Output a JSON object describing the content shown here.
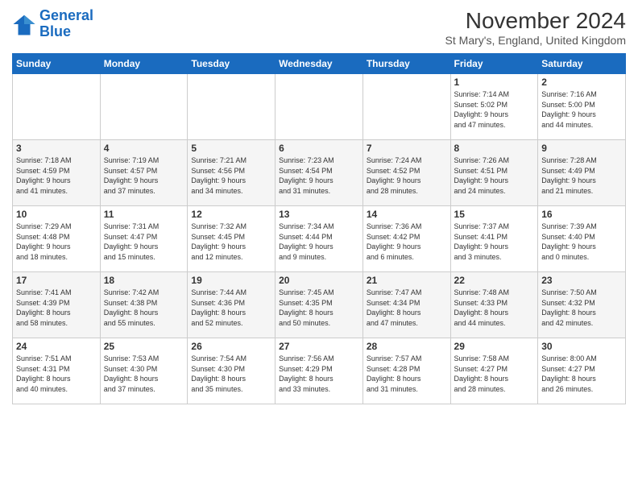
{
  "logo": {
    "line1": "General",
    "line2": "Blue"
  },
  "title": "November 2024",
  "subtitle": "St Mary's, England, United Kingdom",
  "weekdays": [
    "Sunday",
    "Monday",
    "Tuesday",
    "Wednesday",
    "Thursday",
    "Friday",
    "Saturday"
  ],
  "weeks": [
    [
      {
        "day": "",
        "info": ""
      },
      {
        "day": "",
        "info": ""
      },
      {
        "day": "",
        "info": ""
      },
      {
        "day": "",
        "info": ""
      },
      {
        "day": "",
        "info": ""
      },
      {
        "day": "1",
        "info": "Sunrise: 7:14 AM\nSunset: 5:02 PM\nDaylight: 9 hours\nand 47 minutes."
      },
      {
        "day": "2",
        "info": "Sunrise: 7:16 AM\nSunset: 5:00 PM\nDaylight: 9 hours\nand 44 minutes."
      }
    ],
    [
      {
        "day": "3",
        "info": "Sunrise: 7:18 AM\nSunset: 4:59 PM\nDaylight: 9 hours\nand 41 minutes."
      },
      {
        "day": "4",
        "info": "Sunrise: 7:19 AM\nSunset: 4:57 PM\nDaylight: 9 hours\nand 37 minutes."
      },
      {
        "day": "5",
        "info": "Sunrise: 7:21 AM\nSunset: 4:56 PM\nDaylight: 9 hours\nand 34 minutes."
      },
      {
        "day": "6",
        "info": "Sunrise: 7:23 AM\nSunset: 4:54 PM\nDaylight: 9 hours\nand 31 minutes."
      },
      {
        "day": "7",
        "info": "Sunrise: 7:24 AM\nSunset: 4:52 PM\nDaylight: 9 hours\nand 28 minutes."
      },
      {
        "day": "8",
        "info": "Sunrise: 7:26 AM\nSunset: 4:51 PM\nDaylight: 9 hours\nand 24 minutes."
      },
      {
        "day": "9",
        "info": "Sunrise: 7:28 AM\nSunset: 4:49 PM\nDaylight: 9 hours\nand 21 minutes."
      }
    ],
    [
      {
        "day": "10",
        "info": "Sunrise: 7:29 AM\nSunset: 4:48 PM\nDaylight: 9 hours\nand 18 minutes."
      },
      {
        "day": "11",
        "info": "Sunrise: 7:31 AM\nSunset: 4:47 PM\nDaylight: 9 hours\nand 15 minutes."
      },
      {
        "day": "12",
        "info": "Sunrise: 7:32 AM\nSunset: 4:45 PM\nDaylight: 9 hours\nand 12 minutes."
      },
      {
        "day": "13",
        "info": "Sunrise: 7:34 AM\nSunset: 4:44 PM\nDaylight: 9 hours\nand 9 minutes."
      },
      {
        "day": "14",
        "info": "Sunrise: 7:36 AM\nSunset: 4:42 PM\nDaylight: 9 hours\nand 6 minutes."
      },
      {
        "day": "15",
        "info": "Sunrise: 7:37 AM\nSunset: 4:41 PM\nDaylight: 9 hours\nand 3 minutes."
      },
      {
        "day": "16",
        "info": "Sunrise: 7:39 AM\nSunset: 4:40 PM\nDaylight: 9 hours\nand 0 minutes."
      }
    ],
    [
      {
        "day": "17",
        "info": "Sunrise: 7:41 AM\nSunset: 4:39 PM\nDaylight: 8 hours\nand 58 minutes."
      },
      {
        "day": "18",
        "info": "Sunrise: 7:42 AM\nSunset: 4:38 PM\nDaylight: 8 hours\nand 55 minutes."
      },
      {
        "day": "19",
        "info": "Sunrise: 7:44 AM\nSunset: 4:36 PM\nDaylight: 8 hours\nand 52 minutes."
      },
      {
        "day": "20",
        "info": "Sunrise: 7:45 AM\nSunset: 4:35 PM\nDaylight: 8 hours\nand 50 minutes."
      },
      {
        "day": "21",
        "info": "Sunrise: 7:47 AM\nSunset: 4:34 PM\nDaylight: 8 hours\nand 47 minutes."
      },
      {
        "day": "22",
        "info": "Sunrise: 7:48 AM\nSunset: 4:33 PM\nDaylight: 8 hours\nand 44 minutes."
      },
      {
        "day": "23",
        "info": "Sunrise: 7:50 AM\nSunset: 4:32 PM\nDaylight: 8 hours\nand 42 minutes."
      }
    ],
    [
      {
        "day": "24",
        "info": "Sunrise: 7:51 AM\nSunset: 4:31 PM\nDaylight: 8 hours\nand 40 minutes."
      },
      {
        "day": "25",
        "info": "Sunrise: 7:53 AM\nSunset: 4:30 PM\nDaylight: 8 hours\nand 37 minutes."
      },
      {
        "day": "26",
        "info": "Sunrise: 7:54 AM\nSunset: 4:30 PM\nDaylight: 8 hours\nand 35 minutes."
      },
      {
        "day": "27",
        "info": "Sunrise: 7:56 AM\nSunset: 4:29 PM\nDaylight: 8 hours\nand 33 minutes."
      },
      {
        "day": "28",
        "info": "Sunrise: 7:57 AM\nSunset: 4:28 PM\nDaylight: 8 hours\nand 31 minutes."
      },
      {
        "day": "29",
        "info": "Sunrise: 7:58 AM\nSunset: 4:27 PM\nDaylight: 8 hours\nand 28 minutes."
      },
      {
        "day": "30",
        "info": "Sunrise: 8:00 AM\nSunset: 4:27 PM\nDaylight: 8 hours\nand 26 minutes."
      }
    ]
  ]
}
